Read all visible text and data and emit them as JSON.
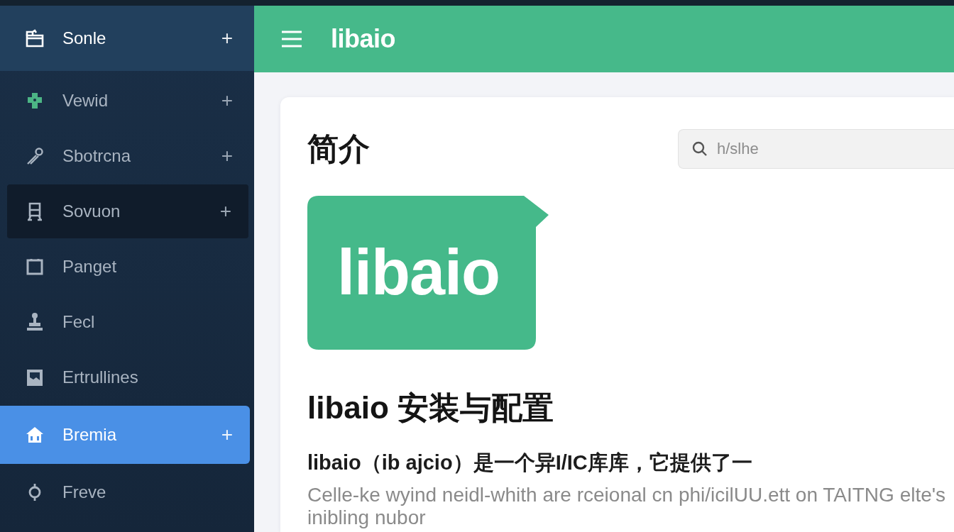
{
  "sidebar": {
    "items": [
      {
        "label": "Sonle",
        "kind": "header",
        "action": "+",
        "selected": false,
        "hovered": false
      },
      {
        "label": "Vewid",
        "kind": "item",
        "action": "+",
        "selected": false,
        "hovered": false
      },
      {
        "label": "Sbotrcna",
        "kind": "item",
        "action": "+",
        "selected": false,
        "hovered": false
      },
      {
        "label": "Sovuon",
        "kind": "item",
        "action": "+",
        "selected": false,
        "hovered": true
      },
      {
        "label": "Panget",
        "kind": "item",
        "selected": false,
        "hovered": false
      },
      {
        "label": "Fecl",
        "kind": "item",
        "selected": false,
        "hovered": false
      },
      {
        "label": "Ertrullines",
        "kind": "item",
        "selected": false,
        "hovered": false
      },
      {
        "label": "Bremia",
        "kind": "item",
        "action": "+",
        "selected": true,
        "hovered": false
      },
      {
        "label": "Freve",
        "kind": "item",
        "selected": false,
        "hovered": false
      }
    ]
  },
  "header": {
    "title": "libaio"
  },
  "card": {
    "title": "简介",
    "search": {
      "placeholder": "h/slhe"
    },
    "logo": {
      "text": "libaio"
    },
    "heading": "libaio 安装与配置",
    "subheading": "libaio（ib ajcio）是一个异I/IC库库，它提供了一",
    "paragraph": "Celle-ke wyind neidl-whith are rceional cn phi/icilUU.ett on TAITNG elte's inibling nubor"
  }
}
